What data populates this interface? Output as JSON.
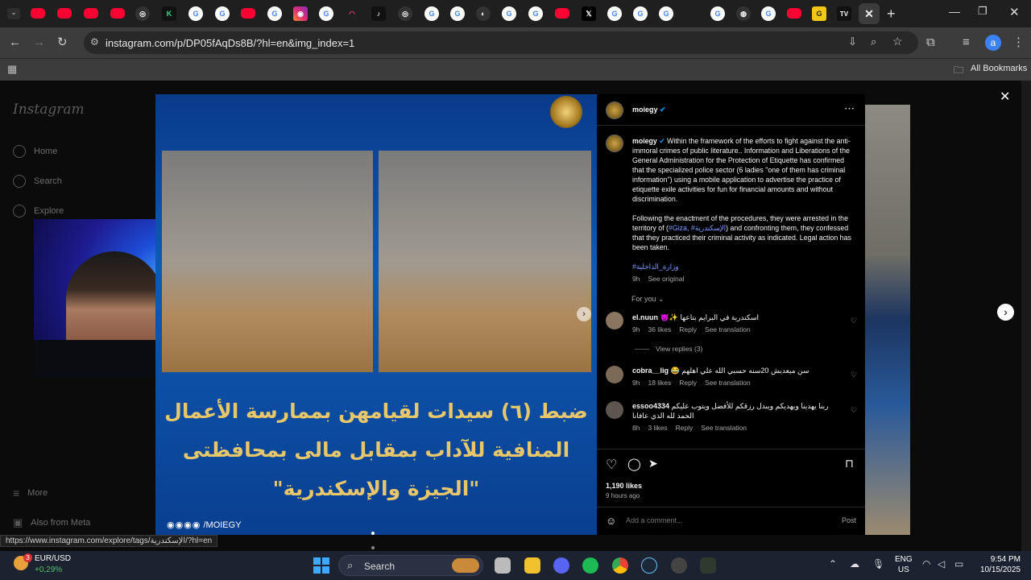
{
  "browser": {
    "url": "instagram.com/p/DP05fAqDs8B/?hl=en&img_index=1",
    "bookmarks_label": "All Bookmarks",
    "profile_initial": "a",
    "status_url": "https://www.instagram.com/explore/tags/الإسكندرية/?hl=en"
  },
  "sidebar": {
    "logo": "Instagram",
    "items": [
      {
        "label": "Home"
      },
      {
        "label": "Search"
      },
      {
        "label": "Explore"
      }
    ],
    "more": "More",
    "also_from_meta": "Also from Meta"
  },
  "post_image": {
    "headline": "ضبط (٦) سيدات لقيامهن بممارسة الأعمال المنافية للآداب بمقابل مالى بمحافظتى \"الجيزة والإسكندرية\"",
    "watermark": "/MOIEGY"
  },
  "post": {
    "username": "moiegy",
    "caption_p1": "Within the framework of the efforts to fight against the anti-immoral crimes of public literature.. Information and Liberations of the General Administration for the Protection of Etiquette has confirmed that the specialized police sector (6 ladies \"one of them has criminal information\") using a mobile application to advertise the practice of etiquette exile activities for fun for financial amounts and without discrimination.",
    "caption_p2_a": "Following the enactment of the procedures, they were arrested in the territory of (",
    "caption_p2_tags": "#Giza, #الإسكندرية",
    "caption_p2_b": ") and confronting them, they confessed that they practiced their criminal activity as indicated. Legal action has been taken.",
    "hashtag": "#وزارة_الداخلية",
    "time": "9h",
    "see_original": "See original",
    "for_you": "For you",
    "likes": "1,190 likes",
    "posted": "9 hours ago",
    "add_comment_placeholder": "Add a comment...",
    "post_button": "Post"
  },
  "comments": [
    {
      "user": "el.nuun",
      "text": "😈✨ اسكندرية في البرايم بتاعها",
      "time": "9h",
      "likes": "36 likes",
      "reply": "Reply",
      "translate": "See translation",
      "view_replies": "View replies (3)"
    },
    {
      "user": "cobra__lig",
      "text": "😂 سن ميعديش 20سنه حسبي الله علي اهلهم",
      "time": "9h",
      "likes": "18 likes",
      "reply": "Reply",
      "translate": "See translation"
    },
    {
      "user": "essoo4334",
      "text": "ربنا يهدينا ويهديكم ويبدل رزقكم للأفضل ويتوب عليكم الحمد لله الذي عافانا",
      "time": "8h",
      "likes": "3 likes",
      "reply": "Reply",
      "translate": "See translation"
    }
  ],
  "taskbar": {
    "ticker_symbol": "EUR/USD",
    "ticker_change": "+0,29%",
    "ticker_badge": "3",
    "search_label": "Search",
    "language_1": "ENG",
    "language_2": "US",
    "time": "9:54 PM",
    "date": "10/15/2025"
  },
  "colors": {
    "accent_link": "#e0f1ff",
    "verified": "#0095f6",
    "hashtag": "#7a9cff",
    "ticker_up": "#4cc26a"
  }
}
